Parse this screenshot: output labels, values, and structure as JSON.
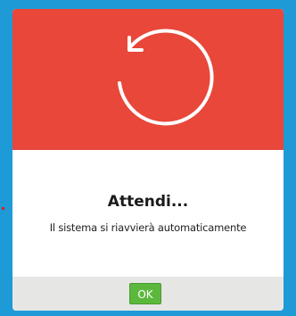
{
  "dialog": {
    "icon": "restart-arrow-icon",
    "title": "Attendi...",
    "message": "Il sistema si riavvierà automaticamente",
    "ok_label": "OK"
  },
  "colors": {
    "background": "#1e9ad6",
    "header": "#e8473a",
    "footer": "#e6e6e4",
    "ok_button": "#5bb83c",
    "icon_stroke": "#ffffff"
  }
}
